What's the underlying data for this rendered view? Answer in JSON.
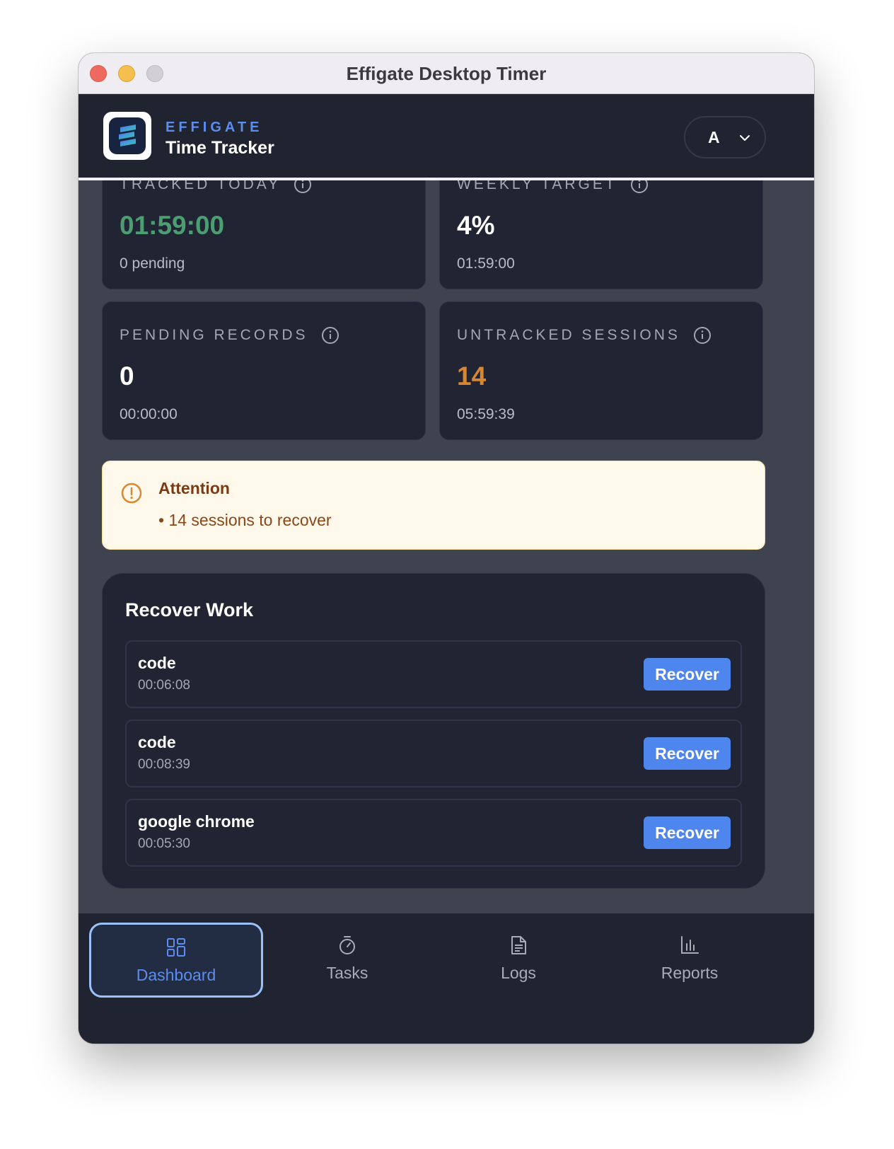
{
  "window": {
    "title": "Effigate Desktop Timer"
  },
  "header": {
    "brand": "EFFIGATE",
    "subtitle": "Time Tracker",
    "account_initial": "A"
  },
  "stats": [
    {
      "label": "TRACKED TODAY",
      "value": "01:59:00",
      "sub": "0 pending",
      "value_color": "#4c9e72"
    },
    {
      "label": "WEEKLY TARGET",
      "value": "4%",
      "sub": "01:59:00",
      "value_color": "#ffffff"
    },
    {
      "label": "PENDING RECORDS",
      "value": "0",
      "sub": "00:00:00",
      "value_color": "#ffffff"
    },
    {
      "label": "UNTRACKED SESSIONS",
      "value": "14",
      "sub": "05:59:39",
      "value_color": "#d9882f"
    }
  ],
  "attention": {
    "title": "Attention",
    "items": [
      "• 14 sessions to recover"
    ]
  },
  "recover": {
    "title": "Recover Work",
    "button_label": "Recover",
    "items": [
      {
        "name": "code",
        "duration": "00:06:08"
      },
      {
        "name": "code",
        "duration": "00:08:39"
      },
      {
        "name": "google chrome",
        "duration": "00:05:30"
      }
    ]
  },
  "nav": {
    "active": "Dashboard",
    "items": [
      {
        "label": "Dashboard",
        "icon": "dashboard-icon"
      },
      {
        "label": "Tasks",
        "icon": "stopwatch-icon"
      },
      {
        "label": "Logs",
        "icon": "document-icon"
      },
      {
        "label": "Reports",
        "icon": "bar-chart-icon"
      }
    ]
  },
  "colors": {
    "accent": "#4f86ed",
    "brand": "#5b8def",
    "tracked_green": "#4c9e72",
    "untracked_orange": "#d9882f",
    "attention_bg": "#fef9ea"
  }
}
